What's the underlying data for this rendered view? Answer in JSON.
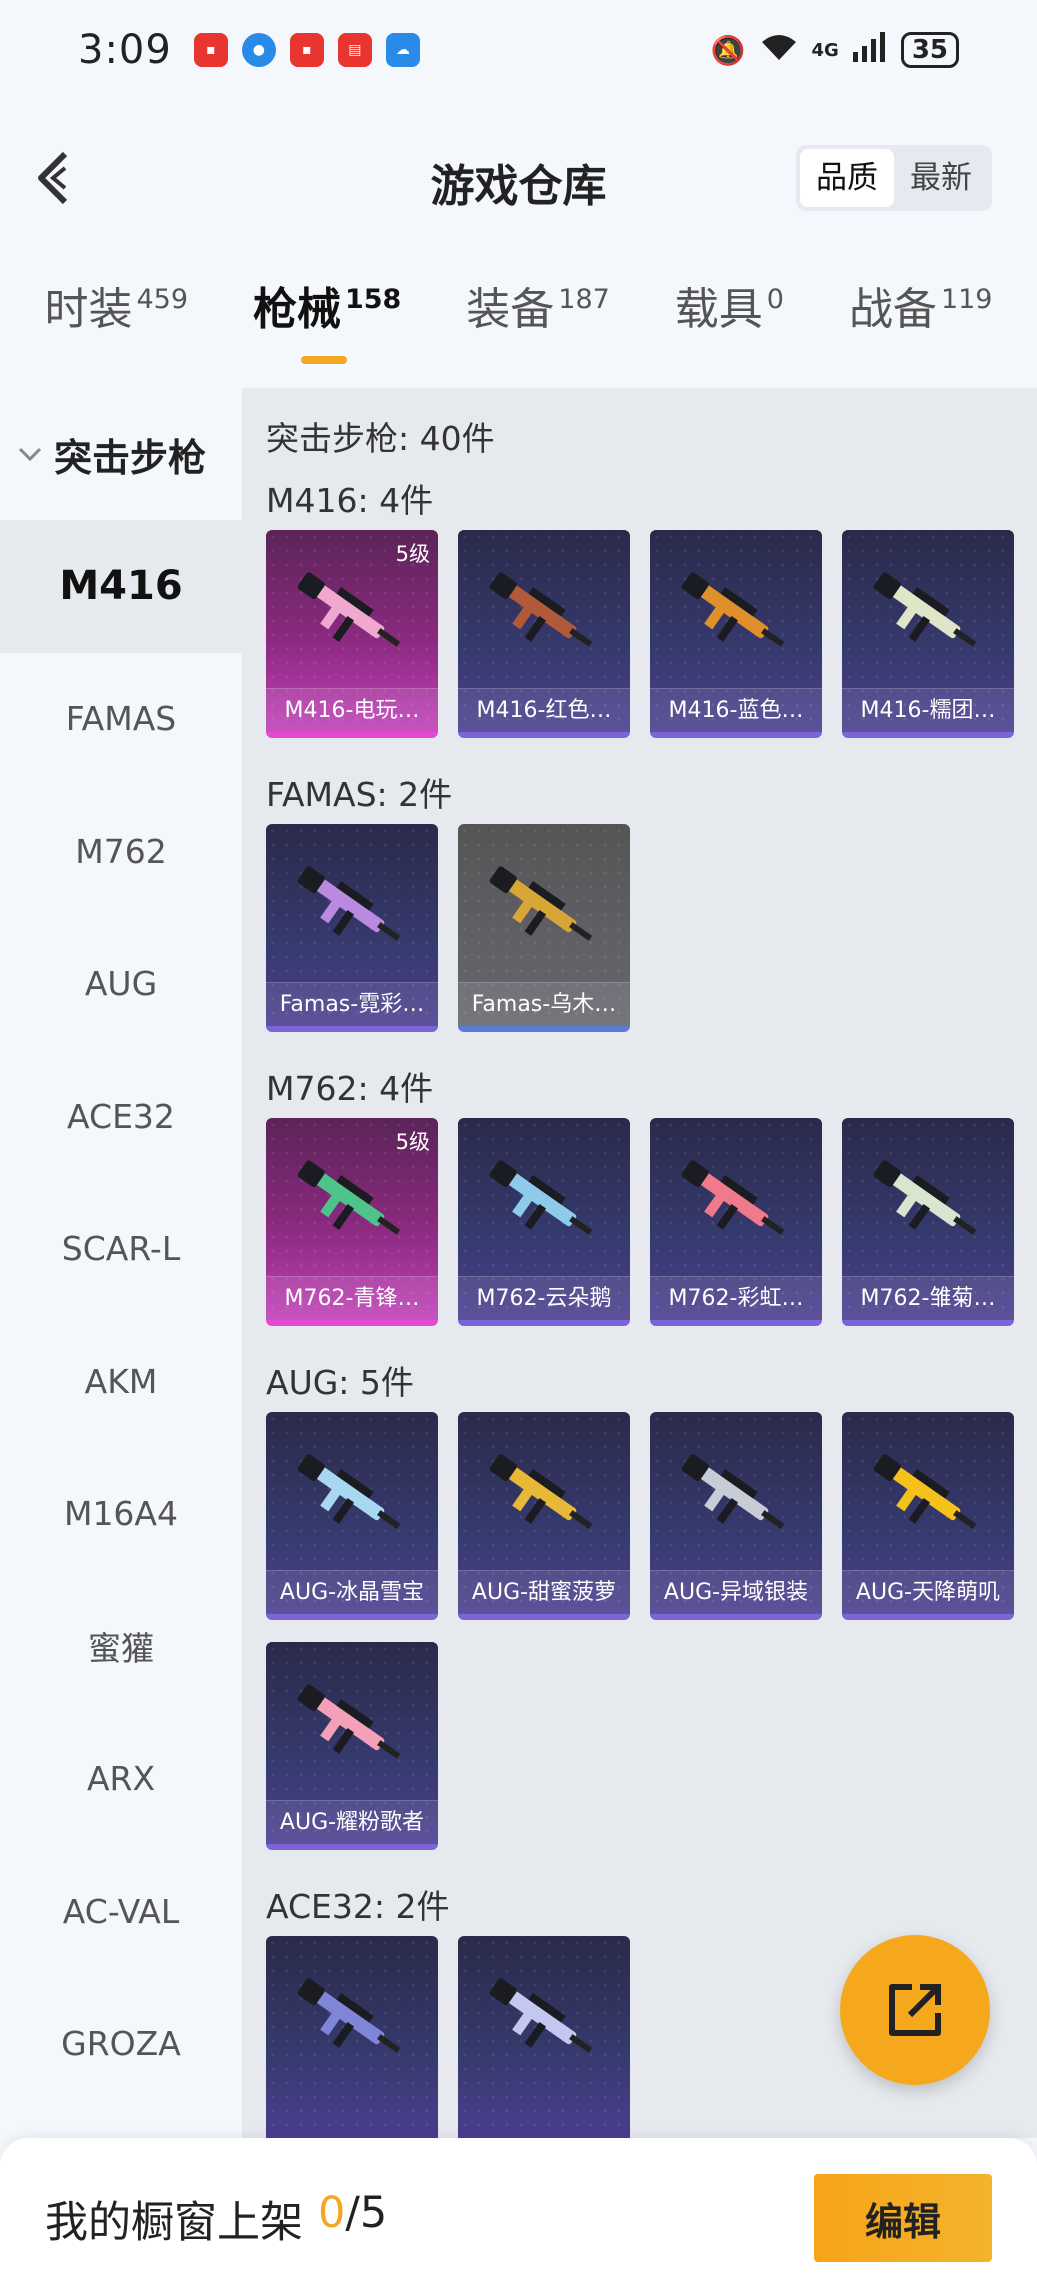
{
  "status_bar": {
    "time": "3:09",
    "notifications": [
      "huawei-app-icon",
      "browser-icon",
      "huawei-app-icon",
      "book-app-icon",
      "weather-icon"
    ],
    "network": "4G",
    "battery": "35"
  },
  "header": {
    "title": "游戏仓库",
    "sort_options": [
      {
        "label": "品质",
        "active": true
      },
      {
        "label": "最新",
        "active": false
      }
    ]
  },
  "tabs": [
    {
      "label": "时装",
      "count": "459",
      "active": false
    },
    {
      "label": "枪械",
      "count": "158",
      "active": true
    },
    {
      "label": "装备",
      "count": "187",
      "active": false
    },
    {
      "label": "载具",
      "count": "0",
      "active": false
    },
    {
      "label": "战备",
      "count": "119",
      "active": false
    }
  ],
  "sidebar": {
    "group_label": "突击步枪",
    "items": [
      {
        "label": "M416",
        "active": true
      },
      {
        "label": "FAMAS",
        "active": false
      },
      {
        "label": "M762",
        "active": false
      },
      {
        "label": "AUG",
        "active": false
      },
      {
        "label": "ACE32",
        "active": false
      },
      {
        "label": "SCAR-L",
        "active": false
      },
      {
        "label": "AKM",
        "active": false
      },
      {
        "label": "M16A4",
        "active": false
      },
      {
        "label": "蜜獾",
        "active": false
      },
      {
        "label": "ARX",
        "active": false
      },
      {
        "label": "AC-VAL",
        "active": false
      },
      {
        "label": "GROZA",
        "active": false
      }
    ]
  },
  "content": {
    "total_label": "突击步枪: 40件",
    "sections": [
      {
        "title": "M416: 4件",
        "items": [
          {
            "name": "M416-电玩…",
            "level": "5级",
            "rarity": "gold",
            "color": "#f0a8d0"
          },
          {
            "name": "M416-红色…",
            "level": "",
            "rarity": "purple",
            "color": "#b05a3a"
          },
          {
            "name": "M416-蓝色…",
            "level": "",
            "rarity": "purple",
            "color": "#e0902a"
          },
          {
            "name": "M416-糯团…",
            "level": "",
            "rarity": "purple",
            "color": "#dfe6c8"
          }
        ]
      },
      {
        "title": "FAMAS: 2件",
        "items": [
          {
            "name": "Famas-霓彩…",
            "level": "",
            "rarity": "purple",
            "color": "#b98ae0"
          },
          {
            "name": "Famas-乌木…",
            "level": "",
            "rarity": "gray",
            "color": "#d8a637"
          }
        ]
      },
      {
        "title": "M762: 4件",
        "items": [
          {
            "name": "M762-青锋…",
            "level": "5级",
            "rarity": "gold",
            "color": "#4ec48a"
          },
          {
            "name": "M762-云朵鹅",
            "level": "",
            "rarity": "purple",
            "color": "#8ecbea"
          },
          {
            "name": "M762-彩虹…",
            "level": "",
            "rarity": "purple",
            "color": "#f07a8c"
          },
          {
            "name": "M762-雏菊…",
            "level": "",
            "rarity": "purple",
            "color": "#d9e6cf"
          }
        ]
      },
      {
        "title": "AUG: 5件",
        "items": [
          {
            "name": "AUG-冰晶雪宝",
            "level": "",
            "rarity": "purple",
            "color": "#a8d7f2"
          },
          {
            "name": "AUG-甜蜜菠萝",
            "level": "",
            "rarity": "purple",
            "color": "#e8b838"
          },
          {
            "name": "AUG-异域银装",
            "level": "",
            "rarity": "purple",
            "color": "#c8ccd6"
          },
          {
            "name": "AUG-天降萌叽",
            "level": "",
            "rarity": "purple",
            "color": "#f5c21c"
          },
          {
            "name": "AUG-耀粉歌者",
            "level": "",
            "rarity": "purple",
            "color": "#f3a0b8"
          }
        ]
      },
      {
        "title": "ACE32: 2件",
        "items": [
          {
            "name": "",
            "level": "",
            "rarity": "purple",
            "color": "#7f86d8"
          },
          {
            "name": "",
            "level": "",
            "rarity": "purple",
            "color": "#c4c8f0"
          }
        ]
      }
    ]
  },
  "share_button_icon": "share-icon",
  "bottom_bar": {
    "label": "我的橱窗上架",
    "current": "0",
    "separator_total": "/5",
    "edit_label": "编辑"
  }
}
